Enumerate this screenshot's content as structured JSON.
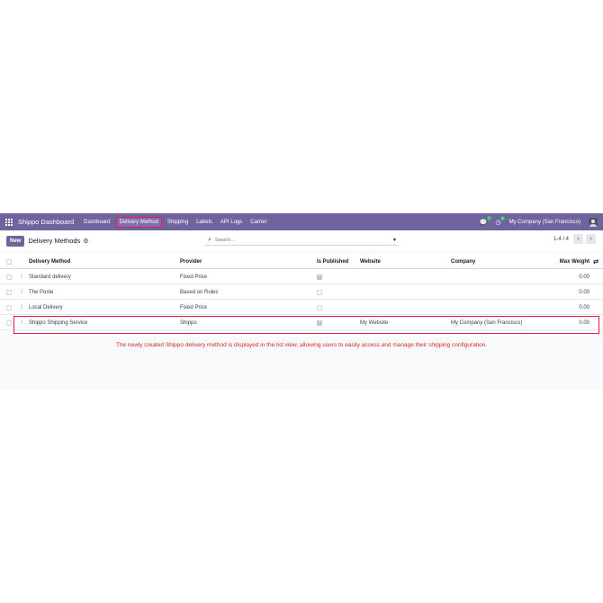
{
  "navbar": {
    "brand": "Shippo Dashboard",
    "menu": [
      {
        "label": "Dashboard",
        "active": false
      },
      {
        "label": "Delivery Method",
        "active": true
      },
      {
        "label": "Shipping",
        "active": false
      },
      {
        "label": "Labels",
        "active": false
      },
      {
        "label": "API Logs",
        "active": false
      },
      {
        "label": "Carrier",
        "active": false
      }
    ],
    "messages_badge": "7",
    "activity_badge": "4",
    "company": "My Company (San Francisco)"
  },
  "control": {
    "new_label": "New",
    "title": "Delivery Methods",
    "search_placeholder": "Search...",
    "pager": "1-4 / 4"
  },
  "table": {
    "headers": [
      "Delivery Method",
      "Provider",
      "Is Published",
      "Website",
      "Company",
      "Max Weight"
    ],
    "rows": [
      {
        "name": "Standard delivery",
        "provider": "Fixed Price",
        "published": true,
        "website": "",
        "company": "",
        "weight": "0.00"
      },
      {
        "name": "The Poste",
        "provider": "Based on Rules",
        "published": false,
        "website": "",
        "company": "",
        "weight": "0.00"
      },
      {
        "name": "Local Delivery",
        "provider": "Fixed Price",
        "published": false,
        "website": "",
        "company": "",
        "weight": "0.00"
      },
      {
        "name": "Shippo Shipping Service",
        "provider": "Shippo",
        "published": true,
        "website": "My Website",
        "company": "My Company (San Francisco)",
        "weight": "0.00"
      }
    ]
  },
  "annotation": "The newly created Shippo delivery method is displayed in the list view, allowing users to easily access and manage their shipping configuration.",
  "colors": {
    "navbar": "#71639e",
    "highlight": "#e11d48",
    "annotation": "#dc2626"
  }
}
